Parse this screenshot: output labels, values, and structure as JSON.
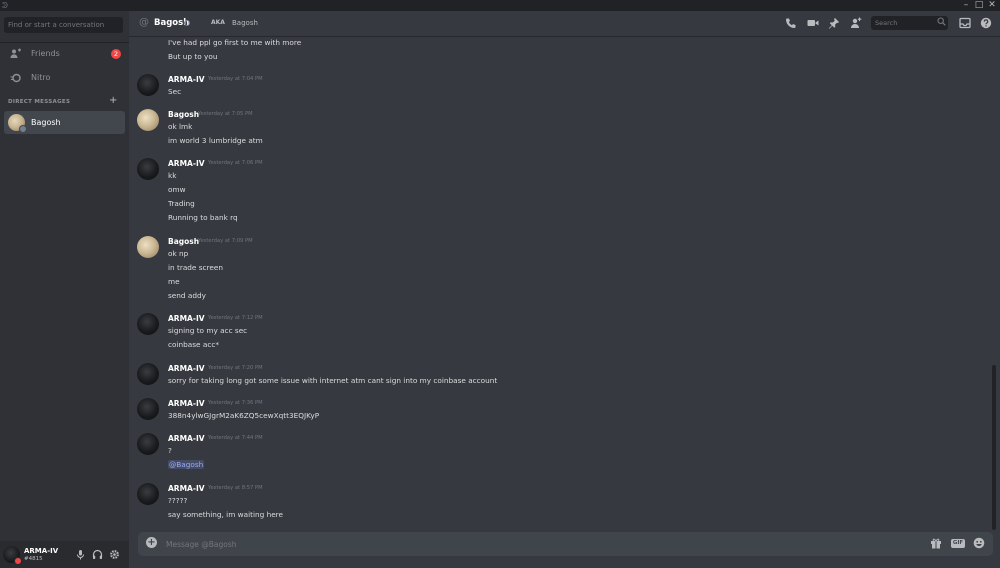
{
  "window": {
    "minimize": "–",
    "maximize": "□",
    "close": "✕",
    "logo": "ᕲ"
  },
  "sidebar": {
    "search_placeholder": "Find or start a conversation",
    "friends_label": "Friends",
    "friends_badge": "2",
    "nitro_label": "Nitro",
    "dm_header": "DIRECT MESSAGES",
    "dm_add": "+",
    "dm_items": [
      {
        "label": "Bagosh"
      }
    ]
  },
  "user_panel": {
    "name": "ARMA-IV",
    "tag": "#4815"
  },
  "header": {
    "channel_name": "Bagosh",
    "aka_label": "AKA",
    "aka_name": "Bagosh",
    "search_placeholder": "Search"
  },
  "messages": [
    {
      "lines": [
        "I've had ppl go first to me with more",
        "But up to you"
      ]
    },
    {
      "author": "ARMA-IV",
      "timestamp": "Yesterday at 7:04 PM",
      "lines": [
        "Sec"
      ]
    },
    {
      "author": "Bagosh",
      "timestamp": "Yesterday at 7:05 PM",
      "lines": [
        "ok lmk",
        "im world 3 lumbridge atm"
      ]
    },
    {
      "author": "ARMA-IV",
      "timestamp": "Yesterday at 7:06 PM",
      "lines": [
        "kk",
        "omw",
        "Trading",
        "Running to bank rq"
      ]
    },
    {
      "author": "Bagosh",
      "timestamp": "Yesterday at 7:09 PM",
      "lines": [
        "ok np",
        "in trade screen",
        "me",
        "send addy"
      ]
    },
    {
      "author": "ARMA-IV",
      "timestamp": "Yesterday at 7:12 PM",
      "lines": [
        "signing to my acc sec",
        "coinbase acc*"
      ]
    },
    {
      "author": "ARMA-IV",
      "timestamp": "Yesterday at 7:20 PM",
      "lines": [
        "sorry for taking long got some issue with internet atm cant sign into my coinbase account"
      ]
    },
    {
      "author": "ARMA-IV",
      "timestamp": "Yesterday at 7:36 PM",
      "lines": [
        "388n4ylwGJgrM2aK6ZQ5cewXqtt3EQJKyP"
      ]
    },
    {
      "author": "ARMA-IV",
      "timestamp": "Yesterday at 7:44 PM",
      "lines": [
        "?",
        "@Bagosh"
      ]
    },
    {
      "author": "ARMA-IV",
      "timestamp": "Yesterday at 8:57 PM",
      "lines": [
        "?????",
        "say something, im waiting here"
      ]
    }
  ],
  "composer": {
    "placeholder": "Message @Bagosh",
    "gif_label": "GIF"
  }
}
